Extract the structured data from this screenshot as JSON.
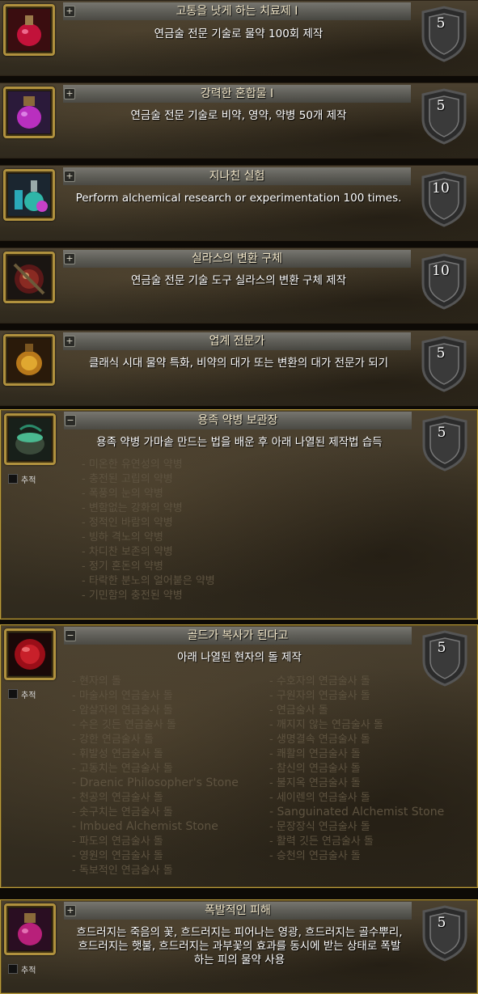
{
  "colors": {
    "title_text": "#f1e6c8",
    "desc_text": "#ffffff",
    "criteria_text": "#5e5340",
    "frame_gold": "#b0913e",
    "expanded_border": "#b89a3a"
  },
  "achievements": [
    {
      "title": "고통을 낫게 하는 치료제 I",
      "toggle": "+",
      "description": "연금술 전문 기술로 물약 100회 제작",
      "points": "5",
      "icon": "red-potion-icon"
    },
    {
      "title": "강력한 혼합물 I",
      "toggle": "+",
      "description": "연금술 전문 기술로 비약, 영약, 약병 50개 제작",
      "points": "5",
      "icon": "purple-flask-icon"
    },
    {
      "title": "지나친 실험",
      "toggle": "+",
      "description": "Perform alchemical research or experimentation 100 times.",
      "points": "10",
      "icon": "alchemy-flasks-icon"
    },
    {
      "title": "실라스의 변환 구체",
      "toggle": "+",
      "description": "연금술 전문 기술 도구 실라스의 변환 구체 제작",
      "points": "10",
      "icon": "transmute-orb-icon"
    },
    {
      "title": "업계 전문가",
      "toggle": "+",
      "description": "클래식 시대 물약 특화, 비약의 대가 또는 변환의 대가 전문가 되기",
      "points": "5",
      "icon": "golden-potion-icon"
    },
    {
      "title": "용족 약병 보관장",
      "toggle": "−",
      "description": "용족 약병 가마솥 만드는 법을 배운 후 아래 나열된 제작법 습득",
      "points": "5",
      "icon": "cauldron-icon",
      "track": "추적",
      "criteria": [
        "- 미온한 유연성의 약병",
        "- 충전된 고립의 약병",
        "- 폭풍의 눈의 약병",
        "- 변함없는 강화의 약병",
        "- 정적인 바람의 약병",
        "- 빙하 격노의 약병",
        "- 차디찬 보존의 약병",
        "- 정기 혼돈의 약병",
        "- 타락한 분노의 얼어붙은 약병",
        "- 기민함의 충전된 약병"
      ]
    },
    {
      "title": "골드가 복사가 된다고",
      "toggle": "−",
      "description": "아래 나열된 현자의 돌 제작",
      "points": "5",
      "icon": "philosopher-stone-icon",
      "track": "추적",
      "criteria_left": [
        "- 현자의 돌",
        "- 마술사의 연금술사 돌",
        "- 암살자의 연금술사 돌",
        "- 수은 깃든 연금술사 돌",
        "- 강한 연금술사 돌",
        "- 휘발성 연금술사 돌",
        "- 고동치는 연금술사 돌",
        "- Draenic Philosopher's Stone",
        "- 천공의 연금술사 돌",
        "- 솟구치는 연금술사 돌",
        "- Imbued Alchemist Stone",
        "- 파도의 연금술사 돌",
        "- 영원의 연금술사 돌",
        "- 독보적인 연금술사 돌"
      ],
      "criteria_right": [
        "- 수호자의 연금술사 돌",
        "- 구원자의 연금술사 돌",
        "- 연금술사 돌",
        "- 깨지지 않는 연금술사 돌",
        "- 생명결속 연금술사 돌",
        "- 쾌활의 연금술사 돌",
        "- 참신의 연금술사 돌",
        "- 불지옥 연금술사 돌",
        "- 세이렌의 연금술사 돌",
        "- Sanguinated Alchemist Stone",
        "- 문장장식 연금술사 돌",
        "- 활력 깃든 연금술사 돌",
        "- 승천의 연금술사 돌"
      ]
    },
    {
      "title": "폭발적인 피해",
      "toggle": "+",
      "description": "흐드러지는 죽음의 꽃, 흐드러지는 피어나는 영광, 흐드러지는 골수뿌리, 흐드러지는 햇불, 흐드러지는 과부꽃의 효과를 동시에 받는 상태로 폭발하는 피의 물약 사용",
      "points": "5",
      "icon": "blood-potion-icon",
      "track": "추적"
    }
  ]
}
